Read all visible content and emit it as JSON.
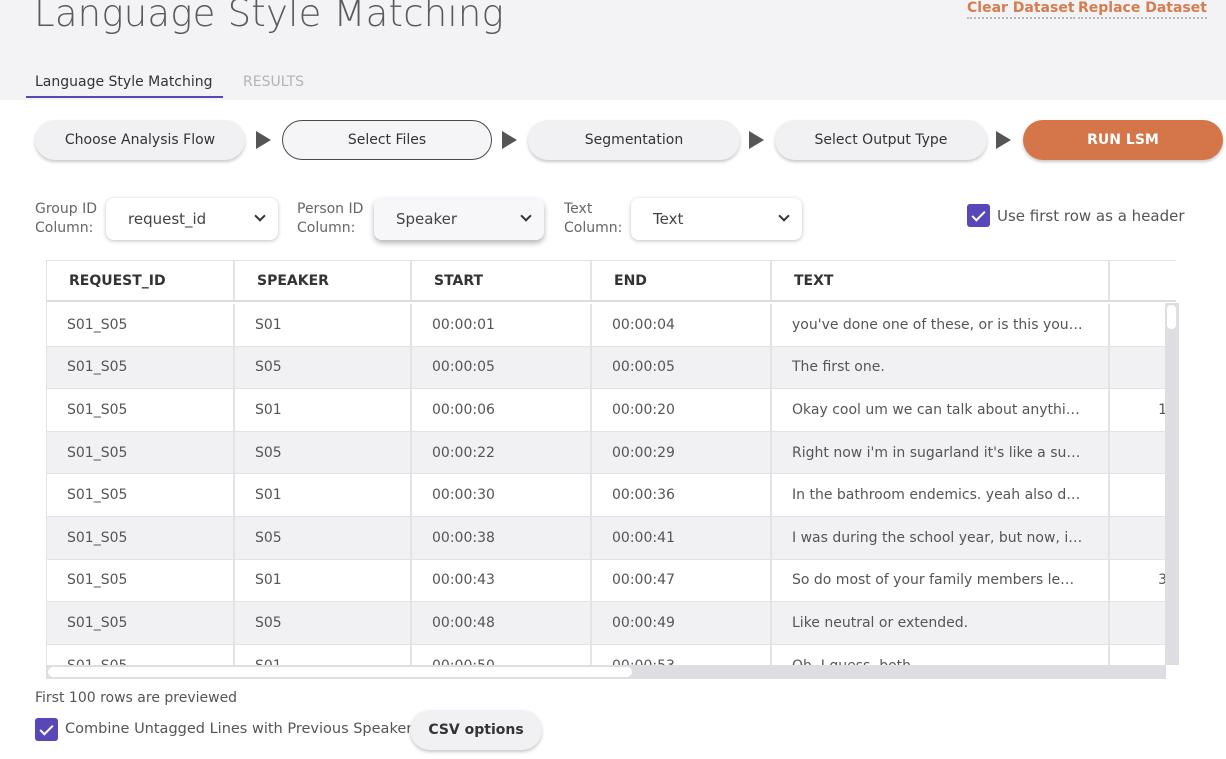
{
  "header": {
    "title": "Language Style Matching",
    "clear_dataset": "Clear Dataset",
    "replace_dataset": "Replace Dataset"
  },
  "tabs": [
    {
      "label": "Language Style Matching",
      "active": true
    },
    {
      "label": "RESULTS",
      "active": false
    }
  ],
  "flow": {
    "steps": [
      "Choose Analysis Flow",
      "Select Files",
      "Segmentation",
      "Select Output Type"
    ],
    "current_step": "Select Files",
    "run_label": "RUN LSM"
  },
  "columns": {
    "group": {
      "label_line1": "Group ID",
      "label_line2": "Column:",
      "value": "request_id"
    },
    "person": {
      "label_line1": "Person ID",
      "label_line2": "Column:",
      "value": "Speaker"
    },
    "text": {
      "label_line1": "Text",
      "label_line2": "Column:",
      "value": "Text"
    }
  },
  "header_checkbox": {
    "label": "Use first row as a header",
    "checked": true
  },
  "table": {
    "headers": [
      "REQUEST_ID",
      "SPEAKER",
      "START",
      "END",
      "TEXT",
      ""
    ],
    "rows": [
      [
        "S01_S05",
        "S01",
        "00:00:01",
        "00:00:04",
        "you've done one of these, or is this your first?",
        ""
      ],
      [
        "S01_S05",
        "S05",
        "00:00:05",
        "00:00:05",
        "The first one.",
        ""
      ],
      [
        "S01_S05",
        "S01",
        "00:00:06",
        "00:00:20",
        "Okay cool um we can talk about anything you want",
        "1"
      ],
      [
        "S01_S05",
        "S05",
        "00:00:22",
        "00:00:29",
        "Right now i'm in sugarland it's like a suburb of Houston",
        ""
      ],
      [
        "S01_S05",
        "S01",
        "00:00:30",
        "00:00:36",
        "In the bathroom endemics. yeah also during the year",
        ""
      ],
      [
        "S01_S05",
        "S05",
        "00:00:38",
        "00:00:41",
        "I was during the school year, but now, in the summer",
        ""
      ],
      [
        "S01_S05",
        "S01",
        "00:00:43",
        "00:00:47",
        "So do most of your family members lemme ask you",
        "3"
      ],
      [
        "S01_S05",
        "S05",
        "00:00:48",
        "00:00:49",
        "Like neutral or extended.",
        ""
      ],
      [
        "S01_S05",
        "S01",
        "00:00:50",
        "00:00:53",
        "Oh, I guess, both.",
        ""
      ]
    ]
  },
  "footer": {
    "preview_note": "First 100 rows are previewed",
    "combine_label": "Combine Untagged Lines with Previous Speaker",
    "combine_checked": true,
    "csv_options": "CSV options"
  },
  "colors": {
    "accent_purple": "#5847b8",
    "run_orange": "#d4754a",
    "link_orange": "#d77c4f"
  }
}
